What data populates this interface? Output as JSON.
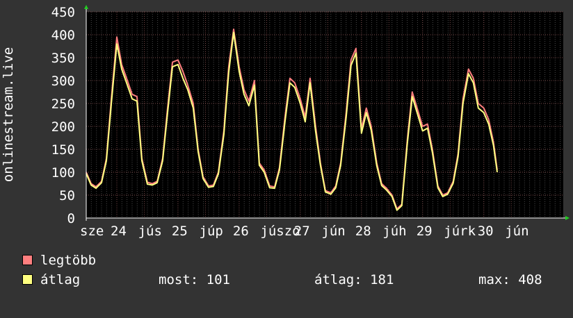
{
  "chart_data": {
    "type": "line",
    "ylabel": "onlinestream.live",
    "ylim": [
      0,
      450
    ],
    "yticks": [
      0,
      50,
      100,
      150,
      200,
      250,
      300,
      350,
      400,
      450
    ],
    "xlim": [
      0,
      7.8
    ],
    "xticks": [
      {
        "x": 0,
        "label": "sze"
      },
      {
        "x": 0.5,
        "label": "24"
      },
      {
        "x": 0.95,
        "label": "jús"
      },
      {
        "x": 1.5,
        "label": "25"
      },
      {
        "x": 1.95,
        "label": "júp"
      },
      {
        "x": 2.5,
        "label": "26"
      },
      {
        "x": 2.95,
        "label": "júszo"
      },
      {
        "x": 3.5,
        "label": "27"
      },
      {
        "x": 3.95,
        "label": "jún"
      },
      {
        "x": 4.5,
        "label": "28"
      },
      {
        "x": 4.95,
        "label": "júh"
      },
      {
        "x": 5.5,
        "label": "29"
      },
      {
        "x": 5.95,
        "label": "júrk"
      },
      {
        "x": 6.5,
        "label": "30"
      },
      {
        "x": 6.95,
        "label": "jún"
      }
    ],
    "grid": true,
    "series": [
      {
        "name": "legtöbb",
        "color": "#ff7f7f",
        "points": [
          [
            0,
            100
          ],
          [
            0.08,
            75
          ],
          [
            0.16,
            68
          ],
          [
            0.25,
            80
          ],
          [
            0.33,
            130
          ],
          [
            0.41,
            260
          ],
          [
            0.5,
            395
          ],
          [
            0.58,
            335
          ],
          [
            0.66,
            305
          ],
          [
            0.75,
            270
          ],
          [
            0.83,
            265
          ],
          [
            0.91,
            130
          ],
          [
            1.0,
            78
          ],
          [
            1.08,
            75
          ],
          [
            1.16,
            80
          ],
          [
            1.25,
            130
          ],
          [
            1.33,
            240
          ],
          [
            1.41,
            340
          ],
          [
            1.5,
            345
          ],
          [
            1.58,
            320
          ],
          [
            1.66,
            290
          ],
          [
            1.75,
            250
          ],
          [
            1.83,
            150
          ],
          [
            1.91,
            90
          ],
          [
            2.0,
            70
          ],
          [
            2.08,
            72
          ],
          [
            2.16,
            100
          ],
          [
            2.25,
            190
          ],
          [
            2.33,
            330
          ],
          [
            2.41,
            412
          ],
          [
            2.5,
            330
          ],
          [
            2.58,
            280
          ],
          [
            2.66,
            255
          ],
          [
            2.75,
            300
          ],
          [
            2.83,
            120
          ],
          [
            2.91,
            105
          ],
          [
            3.0,
            70
          ],
          [
            3.08,
            68
          ],
          [
            3.16,
            110
          ],
          [
            3.25,
            220
          ],
          [
            3.33,
            305
          ],
          [
            3.41,
            295
          ],
          [
            3.5,
            260
          ],
          [
            3.58,
            220
          ],
          [
            3.66,
            305
          ],
          [
            3.75,
            200
          ],
          [
            3.83,
            120
          ],
          [
            3.91,
            60
          ],
          [
            4.0,
            55
          ],
          [
            4.08,
            70
          ],
          [
            4.16,
            120
          ],
          [
            4.25,
            230
          ],
          [
            4.33,
            345
          ],
          [
            4.41,
            370
          ],
          [
            4.5,
            195
          ],
          [
            4.58,
            240
          ],
          [
            4.66,
            200
          ],
          [
            4.75,
            120
          ],
          [
            4.83,
            75
          ],
          [
            4.91,
            65
          ],
          [
            5.0,
            50
          ],
          [
            5.08,
            20
          ],
          [
            5.16,
            30
          ],
          [
            5.25,
            170
          ],
          [
            5.33,
            275
          ],
          [
            5.41,
            240
          ],
          [
            5.5,
            200
          ],
          [
            5.58,
            205
          ],
          [
            5.66,
            150
          ],
          [
            5.75,
            70
          ],
          [
            5.83,
            50
          ],
          [
            5.91,
            55
          ],
          [
            6.0,
            80
          ],
          [
            6.08,
            140
          ],
          [
            6.16,
            260
          ],
          [
            6.25,
            325
          ],
          [
            6.33,
            305
          ],
          [
            6.41,
            250
          ],
          [
            6.5,
            240
          ],
          [
            6.58,
            215
          ],
          [
            6.66,
            165
          ],
          [
            6.72,
            105
          ]
        ]
      },
      {
        "name": "átlag",
        "color": "#ffff80",
        "points": [
          [
            0,
            97
          ],
          [
            0.08,
            72
          ],
          [
            0.16,
            65
          ],
          [
            0.25,
            77
          ],
          [
            0.33,
            125
          ],
          [
            0.41,
            250
          ],
          [
            0.5,
            380
          ],
          [
            0.58,
            325
          ],
          [
            0.66,
            295
          ],
          [
            0.75,
            260
          ],
          [
            0.83,
            255
          ],
          [
            0.91,
            125
          ],
          [
            1.0,
            74
          ],
          [
            1.08,
            72
          ],
          [
            1.16,
            77
          ],
          [
            1.25,
            125
          ],
          [
            1.33,
            230
          ],
          [
            1.41,
            330
          ],
          [
            1.5,
            335
          ],
          [
            1.58,
            305
          ],
          [
            1.66,
            280
          ],
          [
            1.75,
            240
          ],
          [
            1.83,
            145
          ],
          [
            1.91,
            86
          ],
          [
            2.0,
            67
          ],
          [
            2.08,
            69
          ],
          [
            2.16,
            96
          ],
          [
            2.25,
            182
          ],
          [
            2.33,
            318
          ],
          [
            2.41,
            405
          ],
          [
            2.5,
            320
          ],
          [
            2.58,
            270
          ],
          [
            2.66,
            245
          ],
          [
            2.75,
            290
          ],
          [
            2.83,
            115
          ],
          [
            2.91,
            100
          ],
          [
            3.0,
            66
          ],
          [
            3.08,
            65
          ],
          [
            3.16,
            105
          ],
          [
            3.25,
            210
          ],
          [
            3.33,
            295
          ],
          [
            3.41,
            285
          ],
          [
            3.5,
            250
          ],
          [
            3.58,
            210
          ],
          [
            3.66,
            295
          ],
          [
            3.75,
            190
          ],
          [
            3.83,
            115
          ],
          [
            3.91,
            57
          ],
          [
            4.0,
            52
          ],
          [
            4.08,
            66
          ],
          [
            4.16,
            115
          ],
          [
            4.25,
            220
          ],
          [
            4.33,
            333
          ],
          [
            4.41,
            360
          ],
          [
            4.5,
            185
          ],
          [
            4.58,
            230
          ],
          [
            4.66,
            192
          ],
          [
            4.75,
            114
          ],
          [
            4.83,
            71
          ],
          [
            4.91,
            61
          ],
          [
            5.0,
            47
          ],
          [
            5.08,
            17
          ],
          [
            5.16,
            27
          ],
          [
            5.25,
            162
          ],
          [
            5.33,
            265
          ],
          [
            5.41,
            230
          ],
          [
            5.5,
            190
          ],
          [
            5.58,
            196
          ],
          [
            5.66,
            143
          ],
          [
            5.75,
            66
          ],
          [
            5.83,
            47
          ],
          [
            5.91,
            52
          ],
          [
            6.0,
            76
          ],
          [
            6.08,
            134
          ],
          [
            6.16,
            250
          ],
          [
            6.25,
            315
          ],
          [
            6.33,
            295
          ],
          [
            6.41,
            240
          ],
          [
            6.5,
            230
          ],
          [
            6.58,
            205
          ],
          [
            6.66,
            158
          ],
          [
            6.72,
            100
          ]
        ]
      }
    ]
  },
  "legend": {
    "items": [
      {
        "label": "legtöbb",
        "color": "#ff7f7f"
      },
      {
        "label": "átlag",
        "color": "#ffff80"
      }
    ]
  },
  "stats": {
    "most": "most: 101",
    "atlag": "átlag: 181",
    "max": "max: 408"
  }
}
